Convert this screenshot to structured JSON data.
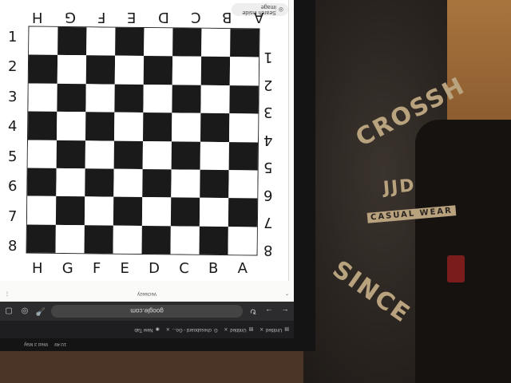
{
  "lens": {
    "search_label": "Search inside image",
    "source": "Vecteezy"
  },
  "board": {
    "top_files": [
      "H",
      "G",
      "F",
      "E",
      "D",
      "C",
      "B",
      "A"
    ],
    "bottom_files": [
      "H",
      "G",
      "F",
      "E",
      "D",
      "C",
      "B",
      "A"
    ],
    "left_ranks": [
      "1",
      "2",
      "3",
      "4",
      "5",
      "6",
      "7",
      "8"
    ],
    "right_ranks": [
      "1",
      "2",
      "3",
      "4",
      "5",
      "6",
      "7",
      "8"
    ]
  },
  "browser": {
    "url": "google.com",
    "tabs": [
      {
        "title": "Untitled"
      },
      {
        "title": "Untitled"
      },
      {
        "title": "chessboard - Go..."
      },
      {
        "title": "New Tab"
      }
    ],
    "time": "10:49",
    "date": "Wed 3 May"
  },
  "shirt": {
    "line1": "CROSSH",
    "line2": "JJD",
    "line3": "CASUAL WEAR",
    "line4": "SINCE"
  }
}
